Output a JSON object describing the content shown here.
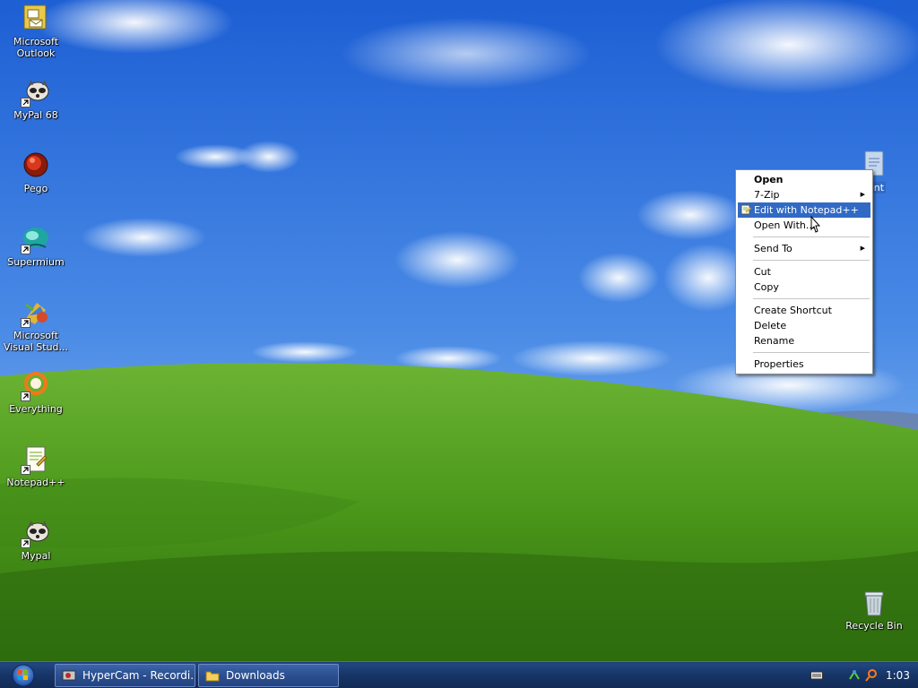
{
  "desktop_icons": [
    {
      "label_line1": "Microsoft",
      "label_line2": "Outlook",
      "icon": "outlook-icon"
    },
    {
      "label_line1": "MyPal 68",
      "label_line2": "",
      "icon": "raccoon-icon"
    },
    {
      "label_line1": "Pego",
      "label_line2": "",
      "icon": "pego-icon"
    },
    {
      "label_line1": "Supermium",
      "label_line2": "",
      "icon": "supermium-icon"
    },
    {
      "label_line1": "Microsoft",
      "label_line2": "Visual Stud...",
      "icon": "visual-studio-icon"
    },
    {
      "label_line1": "Everything",
      "label_line2": "",
      "icon": "everything-icon"
    },
    {
      "label_line1": "Notepad++",
      "label_line2": "",
      "icon": "notepadpp-icon"
    },
    {
      "label_line1": "Mypal",
      "label_line2": "",
      "icon": "raccoon-icon"
    }
  ],
  "recycle_bin": {
    "label": "Recycle Bin",
    "icon": "recycle-bin-icon"
  },
  "selected_file": {
    "label_fragment": "ent",
    "icon": "document-icon"
  },
  "context_menu": {
    "items": [
      {
        "label": "Open",
        "bold": true
      },
      {
        "label": "7-Zip",
        "submenu": true
      },
      {
        "label": "Edit with Notepad++",
        "highlighted": true,
        "icon": "notepadpp-small-icon"
      },
      {
        "label": "Open With..."
      },
      {
        "label": "Send To",
        "submenu": true
      },
      {
        "label": "Cut"
      },
      {
        "label": "Copy"
      },
      {
        "label": "Create Shortcut"
      },
      {
        "label": "Delete"
      },
      {
        "label": "Rename"
      },
      {
        "label": "Properties"
      }
    ]
  },
  "taskbar": {
    "tasks": [
      {
        "label": "HyperCam - Recordi...",
        "icon": "hypercam-icon"
      },
      {
        "label": "Downloads",
        "icon": "folder-icon"
      }
    ],
    "clock": "1:03 PM"
  },
  "colors": {
    "highlight": "#316ac5",
    "taskbar": "#173567"
  }
}
